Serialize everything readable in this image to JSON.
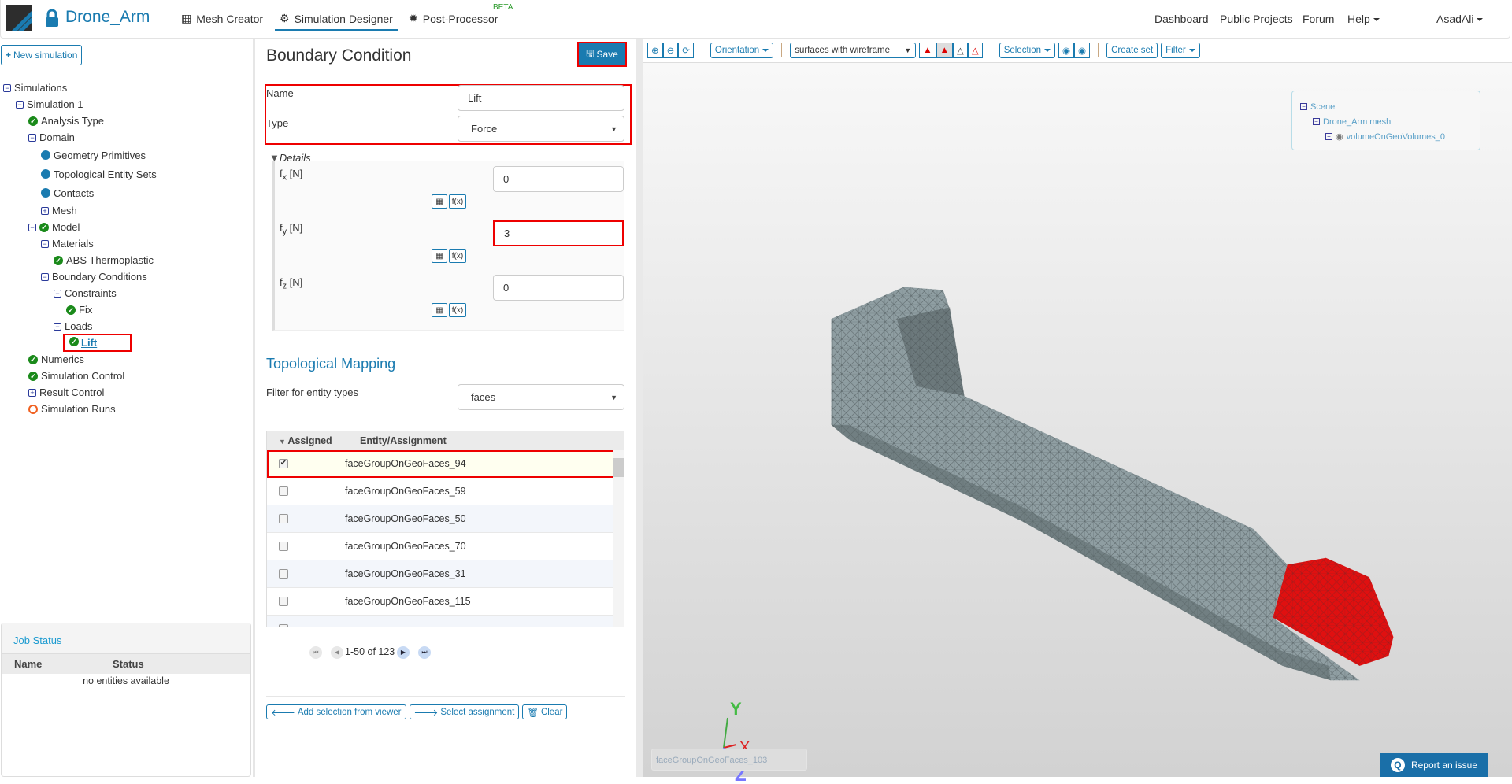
{
  "header": {
    "project": "Drone_Arm",
    "nav": [
      {
        "label": "Mesh Creator",
        "icon": "grid-icon"
      },
      {
        "label": "Simulation Designer",
        "icon": "gears-icon",
        "active": true
      },
      {
        "label": "Post-Processor",
        "icon": "gear-icon",
        "badge": "BETA"
      }
    ],
    "right": [
      "Dashboard",
      "Public Projects",
      "Forum",
      "Help"
    ],
    "user": "AsadAli"
  },
  "left": {
    "new_simulation": "New simulation",
    "tree": [
      {
        "label": "Simulations",
        "level": 0,
        "icon": "collapse"
      },
      {
        "label": "Simulation 1",
        "level": 1,
        "icon": "collapse"
      },
      {
        "label": "Analysis Type",
        "level": 2,
        "icon": "check"
      },
      {
        "label": "Domain",
        "level": 2,
        "icon": "collapse"
      },
      {
        "label": "Geometry Primitives",
        "level": 3,
        "icon": "dot"
      },
      {
        "label": "Topological Entity Sets",
        "level": 3,
        "icon": "dot"
      },
      {
        "label": "Contacts",
        "level": 3,
        "icon": "dot"
      },
      {
        "label": "Mesh",
        "level": 3,
        "icon": "expand"
      },
      {
        "label": "Model",
        "level": 2,
        "icon": "collapse-check"
      },
      {
        "label": "Materials",
        "level": 3,
        "icon": "collapse"
      },
      {
        "label": "ABS Thermoplastic",
        "level": 4,
        "icon": "check"
      },
      {
        "label": "Boundary Conditions",
        "level": 3,
        "icon": "collapse"
      },
      {
        "label": "Constraints",
        "level": 4,
        "icon": "collapse"
      },
      {
        "label": "Fix",
        "level": 5,
        "icon": "check"
      },
      {
        "label": "Loads",
        "level": 4,
        "icon": "collapse"
      },
      {
        "label": "Lift",
        "level": 5,
        "icon": "check",
        "selected": true
      },
      {
        "label": "Numerics",
        "level": 2,
        "icon": "check"
      },
      {
        "label": "Simulation Control",
        "level": 2,
        "icon": "check"
      },
      {
        "label": "Result Control",
        "level": 2,
        "icon": "expand"
      },
      {
        "label": "Simulation Runs",
        "level": 2,
        "icon": "ring"
      }
    ],
    "job_status": {
      "title": "Job Status",
      "columns": [
        "Name",
        "Status"
      ],
      "empty": "no entities available"
    }
  },
  "bc": {
    "title": "Boundary Condition",
    "save": "Save",
    "name_label": "Name",
    "name_value": "Lift",
    "type_label": "Type",
    "type_value": "Force",
    "details": "Details",
    "fields": [
      {
        "label": "f",
        "sub": "x",
        "unit": "[N]",
        "value": "0"
      },
      {
        "label": "f",
        "sub": "y",
        "unit": "[N]",
        "value": "3",
        "highlight": true
      },
      {
        "label": "f",
        "sub": "z",
        "unit": "[N]",
        "value": "0"
      }
    ],
    "fx_label": "f(x)",
    "mapping": {
      "title": "Topological Mapping",
      "filter_label": "Filter for entity types",
      "filter_value": "faces",
      "columns": [
        "Assigned",
        "Entity/Assignment"
      ],
      "rows": [
        {
          "name": "faceGroupOnGeoFaces_94",
          "checked": true
        },
        {
          "name": "faceGroupOnGeoFaces_59",
          "checked": false
        },
        {
          "name": "faceGroupOnGeoFaces_50",
          "checked": false
        },
        {
          "name": "faceGroupOnGeoFaces_70",
          "checked": false
        },
        {
          "name": "faceGroupOnGeoFaces_31",
          "checked": false
        },
        {
          "name": "faceGroupOnGeoFaces_115",
          "checked": false
        }
      ],
      "pagination": "1-50 of 123"
    },
    "actions": [
      "Add selection from viewer",
      "Select assignment",
      "Clear"
    ]
  },
  "viewer": {
    "orientation": "Orientation",
    "render_mode": "surfaces with wireframe",
    "selection": "Selection",
    "create_set": "Create set",
    "filter": "Filter",
    "scene": [
      "Scene",
      "Drone_Arm mesh",
      "volumeOnGeoVolumes_0"
    ],
    "hover_entity": "faceGroupOnGeoFaces_103",
    "report": "Report an issue",
    "axes": [
      "X",
      "Y",
      "Z"
    ],
    "colors": {
      "mesh": "#8f9ea2",
      "selected": "#e01010",
      "accent": "#1a7bb0"
    }
  }
}
